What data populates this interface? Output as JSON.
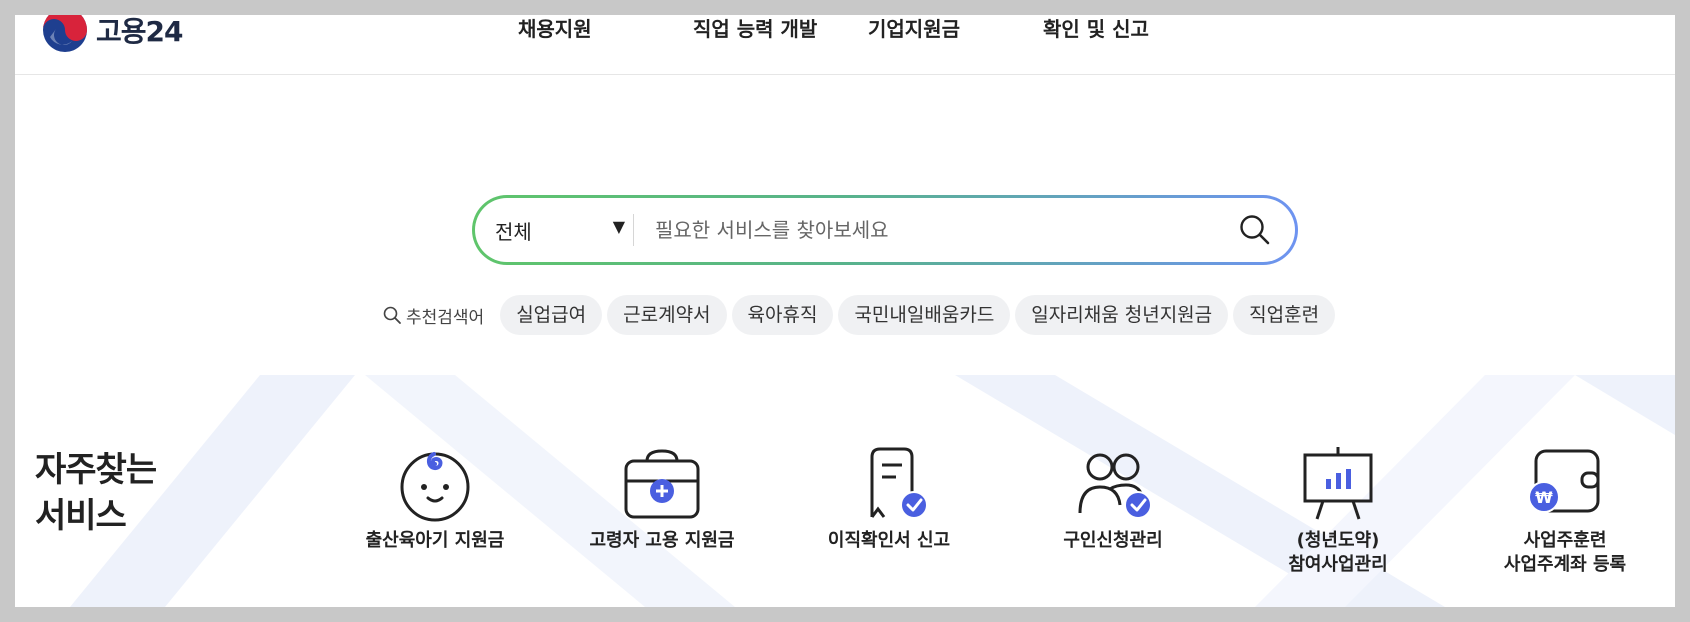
{
  "header": {
    "logo_text": "고용24",
    "nav": [
      {
        "label": "채용지원"
      },
      {
        "label": "직업 능력 개발"
      },
      {
        "label": "기업지원금"
      },
      {
        "label": "확인 및 신고"
      }
    ]
  },
  "search": {
    "scope_value": "전체",
    "placeholder": "필요한 서비스를 찾아보세요",
    "value": ""
  },
  "recommended": {
    "label": "추천검색어",
    "keywords": [
      "실업급여",
      "근로계약서",
      "육아휴직",
      "국민내일배움카드",
      "일자리채움 청년지원금",
      "직업훈련"
    ]
  },
  "services": {
    "title_line1": "자주찾는",
    "title_line2": "서비스",
    "items": [
      {
        "label_line1": "출산육아기 지원금",
        "label_line2": "",
        "icon": "baby-icon"
      },
      {
        "label_line1": "고령자 고용 지원금",
        "label_line2": "",
        "icon": "briefcase-plus-icon"
      },
      {
        "label_line1": "이직확인서 신고",
        "label_line2": "",
        "icon": "receipt-check-icon"
      },
      {
        "label_line1": "구인신청관리",
        "label_line2": "",
        "icon": "people-check-icon"
      },
      {
        "label_line1": "(청년도약)",
        "label_line2": "참여사업관리",
        "icon": "presentation-board-icon"
      },
      {
        "label_line1": "사업주훈련",
        "label_line2": "사업주계좌 등록",
        "icon": "wallet-won-icon"
      }
    ]
  },
  "colors": {
    "accent_blue": "#4a5fe0",
    "gradient_green": "#5fc56b",
    "gradient_blue": "#6e93f1",
    "chip_bg": "#f0f1f3"
  }
}
